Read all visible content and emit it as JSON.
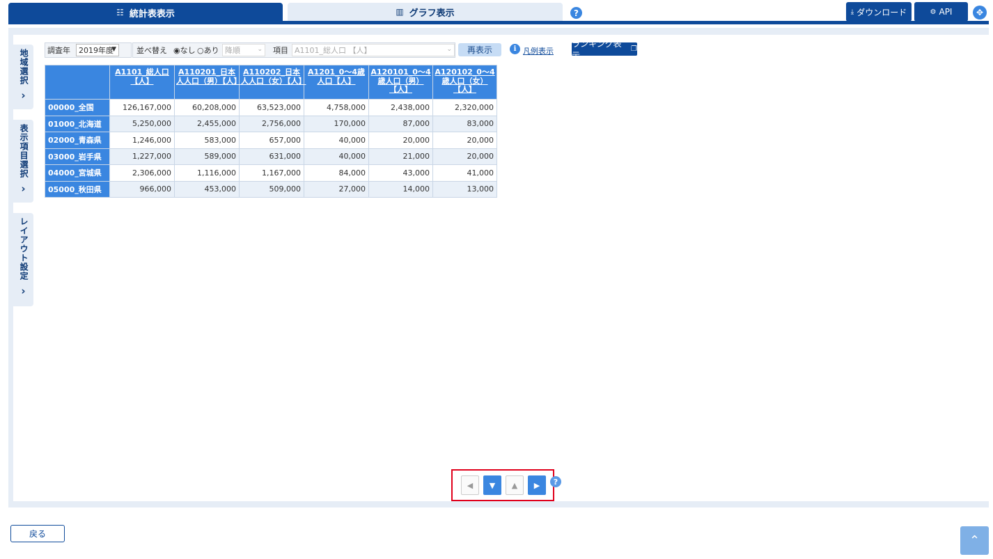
{
  "tabs": {
    "table_label": "統計表表示",
    "table_icon": "table-grid-icon",
    "graph_label": "グラフ表示",
    "graph_icon": "bar-chart-icon"
  },
  "toolbar": {
    "download_label": "ダウンロード",
    "api_label": "API"
  },
  "side_tabs": {
    "area": "地域選択",
    "items": "表示項目選択",
    "layout": "レイアウト設定"
  },
  "controls": {
    "year_label": "調査年",
    "year_value": "2019年度",
    "sort_label": "並べ替え",
    "sort_none": "なし",
    "sort_yes": "あり",
    "order_value": "降順",
    "item_label": "項目",
    "item_value": "A1101_総人口 【人】",
    "redisplay": "再表示",
    "legend": "凡例表示",
    "ranking": "ランキング表示"
  },
  "table": {
    "columns": [
      "A1101_総人口【人】",
      "A110201_日本人人口（男）【人】",
      "A110202_日本人人口（女）【人】",
      "A1201_0～4歳人口【人】",
      "A120101_0～4歳人口（男）【人】",
      "A120102_0～4歳人口（女）【人】"
    ],
    "rows": [
      {
        "region": "00000_全国",
        "values": [
          "126,167,000",
          "60,208,000",
          "63,523,000",
          "4,758,000",
          "2,438,000",
          "2,320,000"
        ]
      },
      {
        "region": "01000_北海道",
        "values": [
          "5,250,000",
          "2,455,000",
          "2,756,000",
          "170,000",
          "87,000",
          "83,000"
        ]
      },
      {
        "region": "02000_青森県",
        "values": [
          "1,246,000",
          "583,000",
          "657,000",
          "40,000",
          "20,000",
          "20,000"
        ]
      },
      {
        "region": "03000_岩手県",
        "values": [
          "1,227,000",
          "589,000",
          "631,000",
          "40,000",
          "21,000",
          "20,000"
        ]
      },
      {
        "region": "04000_宮城県",
        "values": [
          "2,306,000",
          "1,116,000",
          "1,167,000",
          "84,000",
          "43,000",
          "41,000"
        ]
      },
      {
        "region": "05000_秋田県",
        "values": [
          "966,000",
          "453,000",
          "509,000",
          "27,000",
          "14,000",
          "13,000"
        ]
      }
    ]
  },
  "bottom": {
    "back": "戻る"
  },
  "colors": {
    "primary": "#0e4a9a",
    "accent": "#3a86e0",
    "highlight": "#e0001b"
  }
}
